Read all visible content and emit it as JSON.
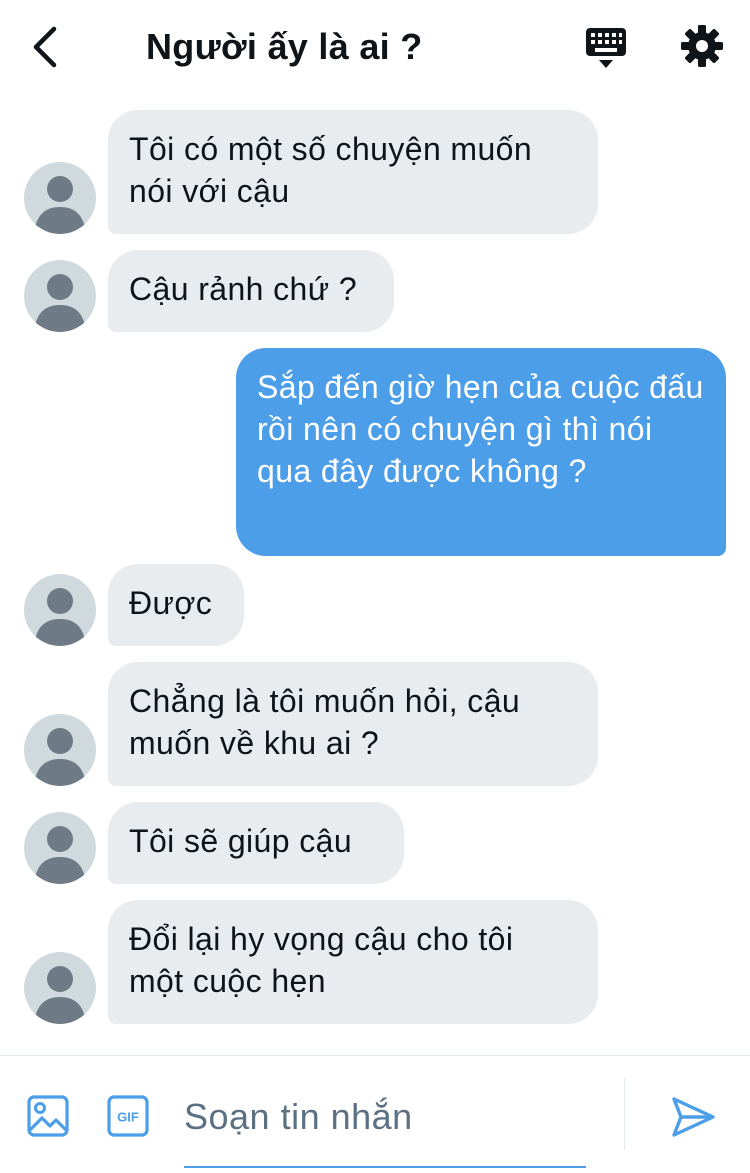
{
  "header": {
    "title": "Người ấy là ai ?",
    "back_icon": "chevron-left-icon",
    "keyboard_icon": "keyboard-icon",
    "settings_icon": "gear-icon"
  },
  "messages": [
    {
      "direction": "received",
      "text": "Tôi có một số chuyện muốn nói với cậu"
    },
    {
      "direction": "received",
      "text": "Cậu rảnh chứ ?"
    },
    {
      "direction": "sent",
      "text": "Sắp đến giờ hẹn của cuộc đấu rồi nên có chuyện gì thì nói qua đây được không ?"
    },
    {
      "direction": "received",
      "text": "Được"
    },
    {
      "direction": "received",
      "text": "Chẳng là tôi muốn hỏi, cậu muốn về khu ai ?"
    },
    {
      "direction": "received",
      "text": "Tôi sẽ giúp cậu"
    },
    {
      "direction": "received",
      "text": "Đổi lại hy vọng cậu cho tôi một cuộc hẹn"
    }
  ],
  "composer": {
    "placeholder": "Soạn tin nhắn",
    "value": "",
    "gif_label": "GIF",
    "image_icon": "image-icon",
    "send_icon": "send-icon"
  },
  "colors": {
    "accent": "#4c9ee9",
    "received_bubble": "#e8ecef",
    "avatar_bg": "#cfd9de",
    "avatar_fg": "#6e7b86"
  }
}
